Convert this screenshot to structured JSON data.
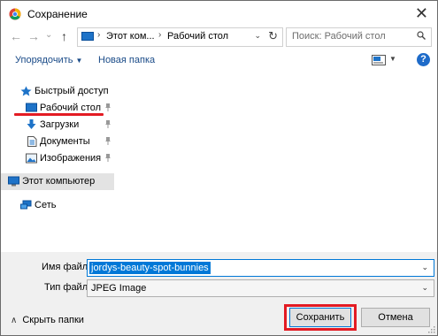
{
  "window": {
    "title": "Сохранение",
    "close_glyph": "✕"
  },
  "nav": {
    "back": "←",
    "forward": "→",
    "recent": "⌄",
    "up": "↑",
    "address": {
      "segments": [
        "Этот ком...",
        "Рабочий стол"
      ],
      "separator": "›",
      "dropdown": "⌄",
      "refresh": "↻"
    },
    "search_placeholder": "Поиск: Рабочий стол"
  },
  "toolbar": {
    "organize": "Упорядочить",
    "new_folder": "Новая папка",
    "dropdown_glyph": "▼",
    "help": "?"
  },
  "sidebar": {
    "quick_access": "Быстрый доступ",
    "items": [
      {
        "label": "Рабочий стол",
        "icon": "desktop-icon",
        "pinned": true
      },
      {
        "label": "Загрузки",
        "icon": "downloads-icon",
        "pinned": true
      },
      {
        "label": "Документы",
        "icon": "documents-icon",
        "pinned": true
      },
      {
        "label": "Изображения",
        "icon": "pictures-icon",
        "pinned": true
      }
    ],
    "this_pc": "Этот компьютер",
    "network": "Сеть"
  },
  "form": {
    "filename_label": "Имя файла:",
    "filename_value": "jordys-beauty-spot-bunnies",
    "filetype_label": "Тип файла:",
    "filetype_value": "JPEG Image",
    "chevron": "⌄"
  },
  "footer": {
    "hide_folders": "Скрыть папки",
    "hide_chevron": "∧",
    "save": "Сохранить",
    "cancel": "Отмена"
  },
  "colors": {
    "accent": "#0078d7",
    "highlight": "#e31b23",
    "link": "#1a4b88"
  }
}
